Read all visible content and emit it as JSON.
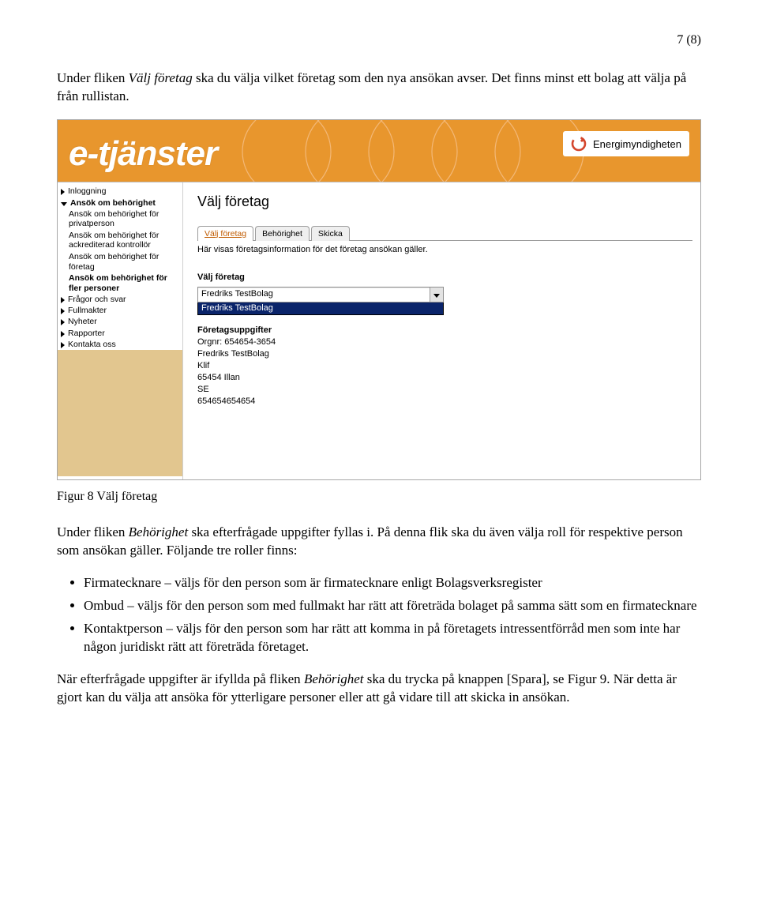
{
  "page_number": "7 (8)",
  "para1_a": "Under fliken ",
  "para1_i": "Välj företag",
  "para1_b": " ska du välja vilket företag som den nya ansökan avser. Det finns minst ett bolag att välja på från rullistan.",
  "figure_caption": "Figur 8 Välj företag",
  "para2_a": "Under fliken ",
  "para2_i": "Behörighet",
  "para2_b": " ska efterfrågade uppgifter fyllas i. På denna flik ska du även välja roll för respektive person som ansökan gäller. Följande tre roller finns:",
  "bullets": [
    "Firmatecknare – väljs för den person som är firmatecknare enligt Bolagsverksregister",
    "Ombud – väljs för den person som med fullmakt har rätt att företräda bolaget på samma sätt som en firmatecknare",
    "Kontaktperson – väljs för den person som har rätt att komma in på företagets intressentförråd men som inte har någon juridiskt rätt att företräda företaget."
  ],
  "para3_a": "När efterfrågade uppgifter är ifyllda på fliken ",
  "para3_i": "Behörighet",
  "para3_b": " ska du trycka på knappen [Spara], se Figur 9. När detta är gjort kan du välja att ansöka för ytterligare personer eller att gå vidare till att skicka in ansökan.",
  "screenshot": {
    "wordmark": "e-tjänster",
    "brand": "Energimyndigheten",
    "nav": {
      "items": [
        {
          "label": "Inloggning",
          "arrow": "right",
          "bold": false
        },
        {
          "label": "Ansök om behörighet",
          "arrow": "down",
          "bold": true
        },
        {
          "label": "Ansök om behörighet för privatperson",
          "sub": true
        },
        {
          "label": "Ansök om behörighet för ackrediterad kontrollör",
          "sub": true
        },
        {
          "label": "Ansök om behörighet för företag",
          "sub": true
        },
        {
          "label": "Ansök om behörighet för fler personer",
          "bold": true,
          "sub": true
        },
        {
          "label": "Frågor och svar",
          "arrow": "right",
          "bold": false
        },
        {
          "label": "Fullmakter",
          "arrow": "right",
          "bold": false
        },
        {
          "label": "Nyheter",
          "arrow": "right",
          "bold": false
        },
        {
          "label": "Rapporter",
          "arrow": "right",
          "bold": false
        },
        {
          "label": "Kontakta oss",
          "arrow": "right",
          "bold": false
        }
      ]
    },
    "main": {
      "title": "Välj företag",
      "tabs": [
        "Välj företag",
        "Behörighet",
        "Skicka"
      ],
      "desc": "Här visas företagsinformation för det företag ansökan gäller.",
      "select_label": "Välj företag",
      "select_value": "Fredriks TestBolag",
      "dd_item": "Fredriks TestBolag",
      "details_heading": "Företagsuppgifter",
      "orgnr_label": "Orgnr: ",
      "orgnr": "654654-3654",
      "name": "Fredriks TestBolag",
      "addr1": "Klif",
      "addr2": "65454 Illan",
      "country": "SE",
      "phone": "654654654654"
    }
  }
}
